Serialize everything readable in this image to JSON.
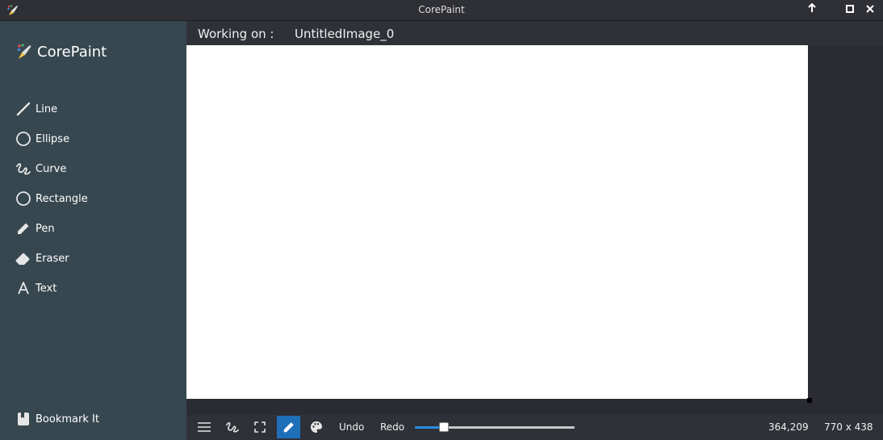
{
  "window": {
    "title": "CorePaint",
    "controls": [
      "arrow-up-icon",
      "maximize-icon",
      "close-icon"
    ]
  },
  "sidebar": {
    "brand": "CorePaint",
    "tools": [
      {
        "label": "Line",
        "icon": "line-icon"
      },
      {
        "label": "Ellipse",
        "icon": "ellipse-icon"
      },
      {
        "label": "Curve",
        "icon": "curve-icon"
      },
      {
        "label": "Rectangle",
        "icon": "rectangle-icon"
      },
      {
        "label": "Pen",
        "icon": "pen-icon"
      },
      {
        "label": "Eraser",
        "icon": "eraser-icon"
      },
      {
        "label": "Text",
        "icon": "text-icon"
      }
    ],
    "bookmark": {
      "label": "Bookmark It",
      "icon": "bookmark-icon"
    }
  },
  "workbar": {
    "label": "Working on :",
    "filename": "UntitledImage_0"
  },
  "bottombar": {
    "undo": "Undo",
    "redo": "Redo",
    "brush_size_fraction": 0.18,
    "coords": "364,209",
    "canvas_size": "770 x 438"
  },
  "colors": {
    "sidebar_bg": "#37474f",
    "accent": "#1e6fb8",
    "slider_fill": "#2a8be0",
    "canvas": "#ffffff"
  }
}
